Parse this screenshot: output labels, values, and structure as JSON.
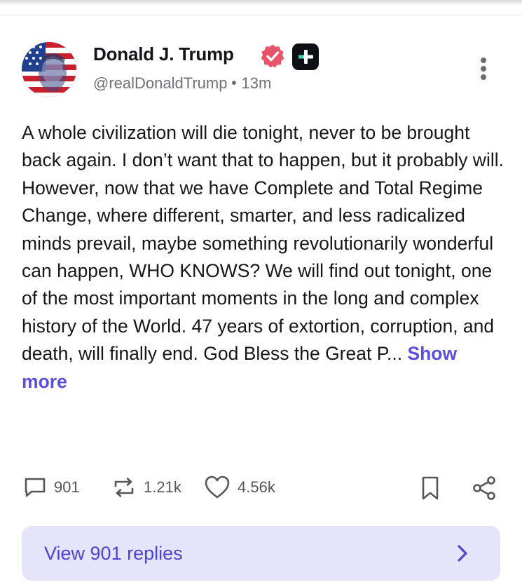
{
  "post": {
    "author_name": "Donald J. Trump",
    "handle": "@realDonaldTrump",
    "time_ago": "13m",
    "text": "A whole civilization will die tonight, never to be brought back again. I don’t want that to happen, but it probably will. However, now that we have Complete and Total Regime Change, where different, smarter, and less radicalized minds prevail, maybe something revolutionarily wonderful can happen, WHO KNOWS? We will find out tonight, one of the most important moments in the long and complex history of the World. 47 years of extortion, corruption, and death, will finally end. God Bless the Great P...",
    "show_more_label": "Show more"
  },
  "actions": {
    "replies_count": "901",
    "reposts_count": "1.21k",
    "likes_count": "4.56k"
  },
  "replies_button": {
    "label": "View 901 replies"
  },
  "icons": {
    "verified": "verified-badge-icon",
    "plus": "plus-badge-icon",
    "more": "more-vertical-icon",
    "reply": "comment-icon",
    "repost": "repost-icon",
    "like": "heart-icon",
    "bookmark": "bookmark-icon",
    "share": "share-icon",
    "chevron": "chevron-right-icon"
  },
  "colors": {
    "accent": "#5b4fe0",
    "verified": "#e8556b",
    "replies_bg": "#e4e5fb",
    "text": "#16171b",
    "muted": "#6f7078"
  }
}
